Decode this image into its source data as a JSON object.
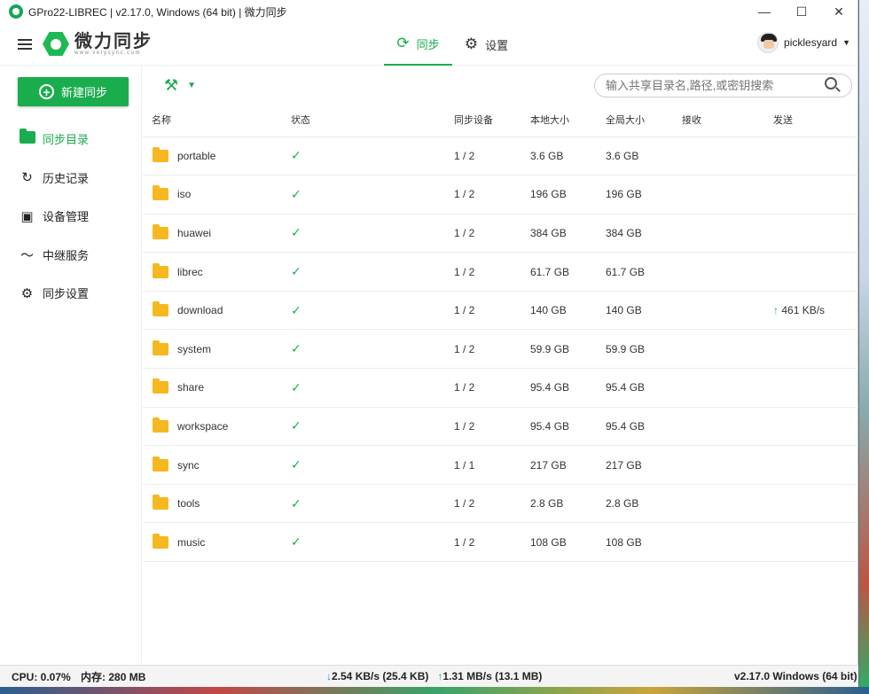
{
  "window": {
    "title": "GPro22-LIBREC | v2.17.0, Windows (64 bit) | 微力同步",
    "min": "—",
    "max": "☐",
    "close": "✕"
  },
  "logo": {
    "name": "微力同步",
    "url": "www.verysync.com"
  },
  "nav": {
    "tabs": [
      {
        "label": "同步"
      },
      {
        "label": "设置"
      }
    ]
  },
  "user": {
    "name": "picklesyard"
  },
  "sidebar": {
    "new_button": "新建同步",
    "items": [
      {
        "label": "同步目录",
        "icon": "folder-icon"
      },
      {
        "label": "历史记录",
        "icon": "history-icon"
      },
      {
        "label": "设备管理",
        "icon": "device-icon"
      },
      {
        "label": "中继服务",
        "icon": "relay-icon"
      },
      {
        "label": "同步设置",
        "icon": "gear-icon"
      }
    ]
  },
  "search": {
    "placeholder": "输入共享目录名,路径,或密钥搜索"
  },
  "table": {
    "headers": [
      "名称",
      "状态",
      "同步设备",
      "本地大小",
      "全局大小",
      "接收",
      "发送"
    ],
    "rows": [
      {
        "name": "portable",
        "devices": "1 / 2",
        "local": "3.6 GB",
        "global": "3.6 GB",
        "recv": "",
        "send": ""
      },
      {
        "name": "iso",
        "devices": "1 / 2",
        "local": "196 GB",
        "global": "196 GB",
        "recv": "",
        "send": ""
      },
      {
        "name": "huawei",
        "devices": "1 / 2",
        "local": "384 GB",
        "global": "384 GB",
        "recv": "",
        "send": ""
      },
      {
        "name": "librec",
        "devices": "1 / 2",
        "local": "61.7 GB",
        "global": "61.7 GB",
        "recv": "",
        "send": ""
      },
      {
        "name": "download",
        "devices": "1 / 2",
        "local": "140 GB",
        "global": "140 GB",
        "recv": "",
        "send": "461 KB/s"
      },
      {
        "name": "system",
        "devices": "1 / 2",
        "local": "59.9 GB",
        "global": "59.9 GB",
        "recv": "",
        "send": ""
      },
      {
        "name": "share",
        "devices": "1 / 2",
        "local": "95.4 GB",
        "global": "95.4 GB",
        "recv": "",
        "send": ""
      },
      {
        "name": "workspace",
        "devices": "1 / 2",
        "local": "95.4 GB",
        "global": "95.4 GB",
        "recv": "",
        "send": ""
      },
      {
        "name": "sync",
        "devices": "1 / 1",
        "local": "217 GB",
        "global": "217 GB",
        "recv": "",
        "send": ""
      },
      {
        "name": "tools",
        "devices": "1 / 2",
        "local": "2.8 GB",
        "global": "2.8 GB",
        "recv": "",
        "send": ""
      },
      {
        "name": "music",
        "devices": "1 / 2",
        "local": "108 GB",
        "global": "108 GB",
        "recv": "",
        "send": ""
      }
    ]
  },
  "status": {
    "cpu": "CPU: 0.07%",
    "mem": "内存: 280 MB",
    "down": "2.54 KB/s (25.4 KB)",
    "up": "1.31 MB/s (13.1 MB)",
    "version": "v2.17.0  Windows (64 bit)"
  },
  "colors": {
    "accent": "#1aad4e",
    "folder": "#f5b820",
    "download": "#2979d8"
  }
}
